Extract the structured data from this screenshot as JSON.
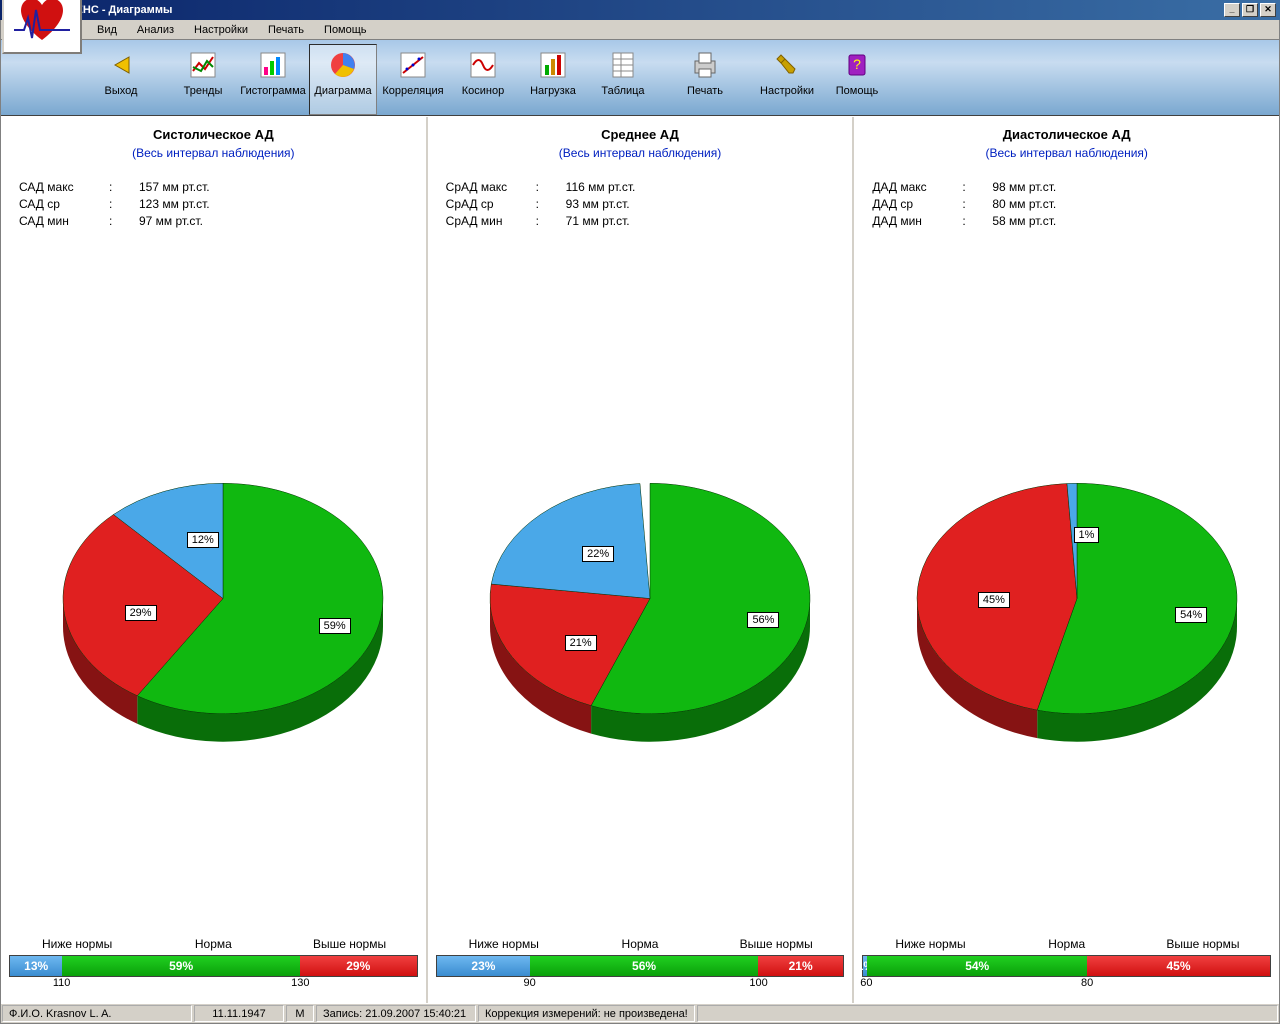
{
  "window": {
    "title": "КАРДИОСЕНС  -  Диаграммы"
  },
  "menu": {
    "items": [
      "Вид",
      "Анализ",
      "Настройки",
      "Печать",
      "Помощь"
    ]
  },
  "toolbar": {
    "exit": "Выход",
    "trends": "Тренды",
    "histogram": "Гистограмма",
    "diagram": "Диаграмма",
    "correlation": "Корреляция",
    "cosinor": "Косинор",
    "load": "Нагрузка",
    "table": "Таблица",
    "print": "Печать",
    "settings": "Настройки",
    "help": "Помощь"
  },
  "legend": {
    "below": "Ниже нормы",
    "norm": "Норма",
    "above": "Выше нормы"
  },
  "panels": [
    {
      "title": "Систолическое АД",
      "subtitle": "(Весь интервал наблюдения)",
      "stats": [
        {
          "k": "САД макс",
          "v": "157 мм рт.ст."
        },
        {
          "k": "САД ср",
          "v": "123 мм рт.ст."
        },
        {
          "k": "САД мин",
          "v": "97 мм рт.ст."
        }
      ],
      "bar": {
        "blue": "13%",
        "green": "59%",
        "red": "29%"
      },
      "ticks": [
        "110",
        "130"
      ]
    },
    {
      "title": "Среднее АД",
      "subtitle": "(Весь интервал наблюдения)",
      "stats": [
        {
          "k": "СрАД макс",
          "v": "116 мм рт.ст."
        },
        {
          "k": "СрАД ср",
          "v": "93 мм рт.ст."
        },
        {
          "k": "СрАД мин",
          "v": "71 мм рт.ст."
        }
      ],
      "bar": {
        "blue": "23%",
        "green": "56%",
        "red": "21%"
      },
      "ticks": [
        "90",
        "100"
      ]
    },
    {
      "title": "Диастолическое АД",
      "subtitle": "(Весь интервал наблюдения)",
      "stats": [
        {
          "k": "ДАД макс",
          "v": "98 мм рт.ст."
        },
        {
          "k": "ДАД ср",
          "v": "80 мм рт.ст."
        },
        {
          "k": "ДАД мин",
          "v": "58 мм рт.ст."
        }
      ],
      "bar": {
        "blue": "1%",
        "green": "54%",
        "red": "45%"
      },
      "ticks": [
        "60",
        "80"
      ]
    }
  ],
  "status": {
    "name": "Ф.И.О.  Krasnov   L.  A.",
    "dob": "11.11.1947",
    "sex": "М",
    "rec": "Запись: 21.09.2007 15:40:21",
    "corr": "Коррекция измерений: не произведена!"
  },
  "chart_data": [
    {
      "type": "pie",
      "title": "Систолическое АД",
      "series": [
        {
          "name": "Ниже нормы",
          "value": 12,
          "color": "#4aa8e8"
        },
        {
          "name": "Норма",
          "value": 59,
          "color": "#10b810"
        },
        {
          "name": "Выше нормы",
          "value": 29,
          "color": "#e02020"
        }
      ],
      "bar_values": {
        "Ниже нормы": 13,
        "Норма": 59,
        "Выше нормы": 29
      },
      "thresholds": [
        110,
        130
      ]
    },
    {
      "type": "pie",
      "title": "Среднее АД",
      "series": [
        {
          "name": "Ниже нормы",
          "value": 22,
          "color": "#4aa8e8"
        },
        {
          "name": "Норма",
          "value": 56,
          "color": "#10b810"
        },
        {
          "name": "Выше нормы",
          "value": 21,
          "color": "#e02020"
        }
      ],
      "bar_values": {
        "Ниже нормы": 23,
        "Норма": 56,
        "Выше нормы": 21
      },
      "thresholds": [
        90,
        100
      ]
    },
    {
      "type": "pie",
      "title": "Диастолическое АД",
      "series": [
        {
          "name": "Ниже нормы",
          "value": 1,
          "color": "#4aa8e8"
        },
        {
          "name": "Норма",
          "value": 54,
          "color": "#10b810"
        },
        {
          "name": "Выше нормы",
          "value": 45,
          "color": "#e02020"
        }
      ],
      "bar_values": {
        "Ниже нормы": 1,
        "Норма": 54,
        "Выше нормы": 45
      },
      "thresholds": [
        60,
        80
      ]
    }
  ]
}
